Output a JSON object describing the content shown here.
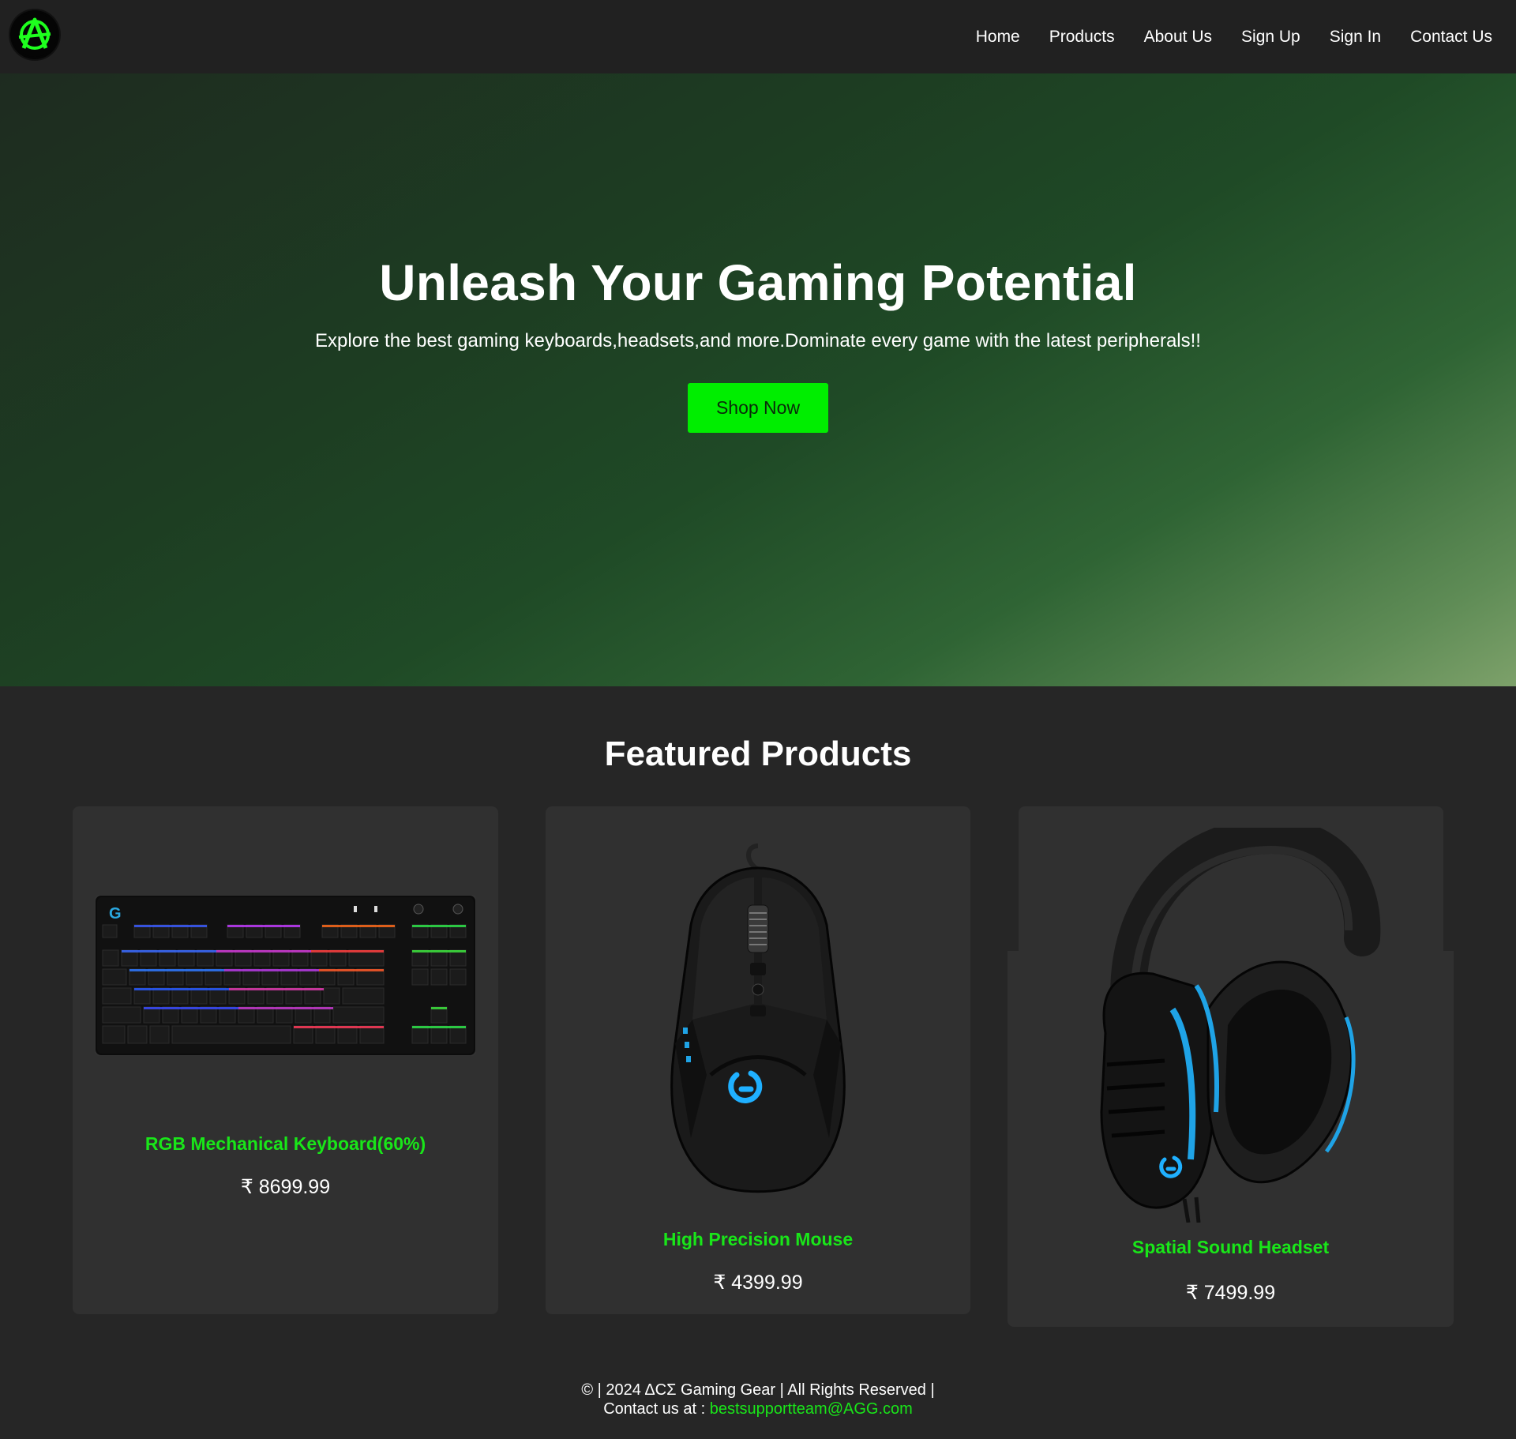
{
  "header": {
    "logo_icon": "anarchy-logo-icon",
    "nav": [
      "Home",
      "Products",
      "About Us",
      "Sign Up",
      "Sign In",
      "Contact Us"
    ]
  },
  "hero": {
    "title": "Unleash Your Gaming Potential",
    "subtitle": "Explore the best gaming keyboards,headsets,and more.Dominate every game with the latest peripherals!!",
    "cta": "Shop Now"
  },
  "featured": {
    "title": "Featured Products",
    "products": [
      {
        "name": "RGB Mechanical Keyboard(60%)",
        "price": "₹ 8699.99",
        "image_icon": "keyboard-image"
      },
      {
        "name": "High Precision Mouse",
        "price": "₹ 4399.99",
        "image_icon": "mouse-image"
      },
      {
        "name": "Spatial Sound Headset",
        "price": "₹ 7499.99",
        "image_icon": "headset-image"
      }
    ]
  },
  "footer": {
    "line1": "© | 2024 ΔCΣ Gaming Gear | All Rights Reserved |",
    "contact_label": "Contact us at : ",
    "contact_email": "bestsupportteam@AGG.com"
  },
  "colors": {
    "accent": "#00ee00",
    "product_title": "#19e619",
    "page_bg": "#262626",
    "card_bg": "#303030",
    "header_bg": "#212121"
  }
}
